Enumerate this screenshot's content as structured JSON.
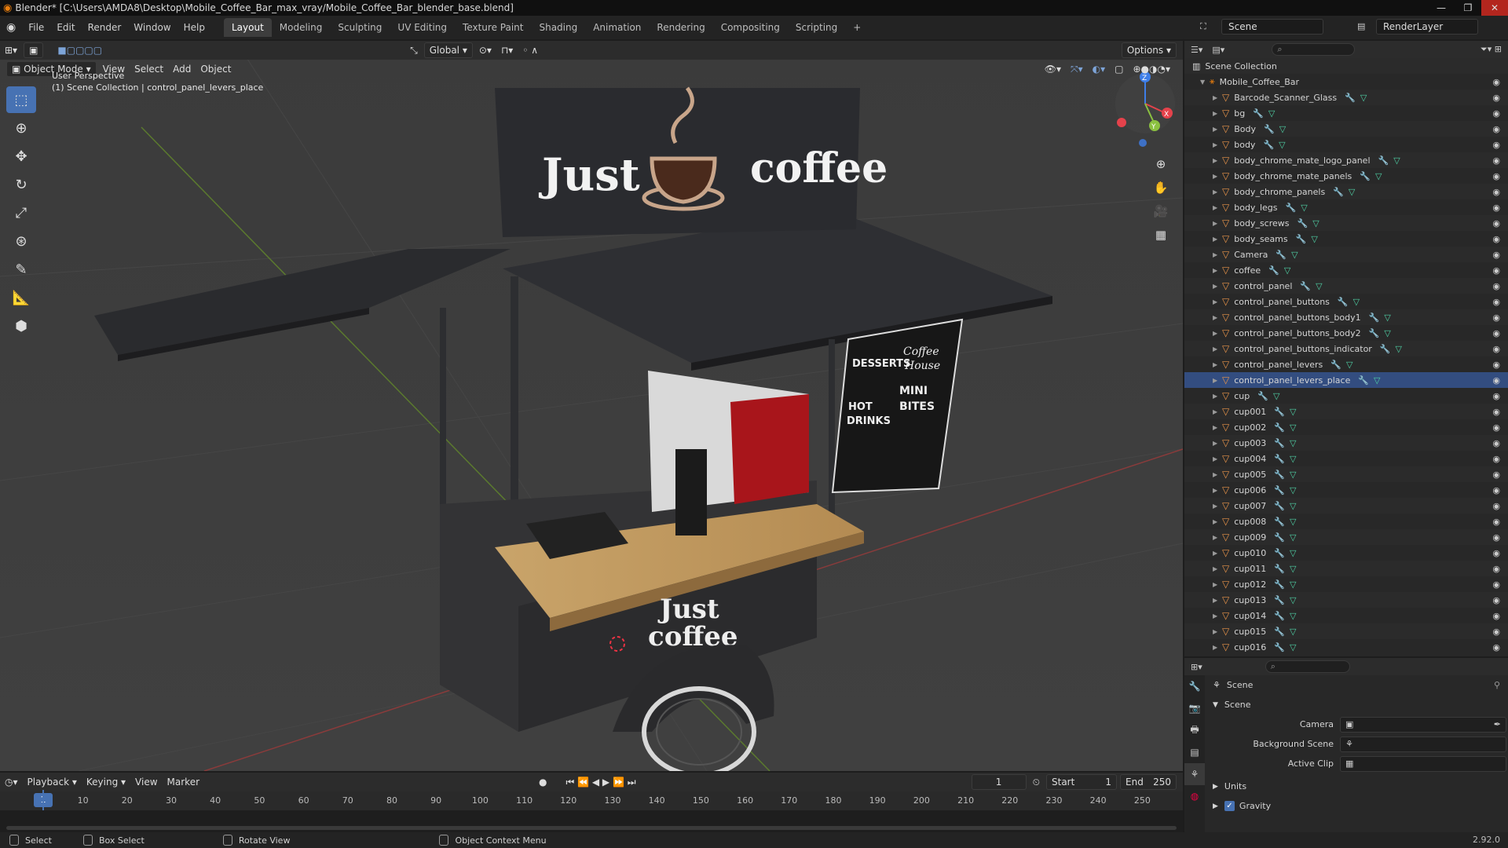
{
  "window": {
    "title": "Blender* [C:\\Users\\AMDA8\\Desktop\\Mobile_Coffee_Bar_max_vray/Mobile_Coffee_Bar_blender_base.blend]",
    "minimize": "—",
    "maximize": "❐",
    "close": "✕"
  },
  "menu": [
    "File",
    "Edit",
    "Render",
    "Window",
    "Help"
  ],
  "workspaces": [
    "Layout",
    "Modeling",
    "Sculpting",
    "UV Editing",
    "Texture Paint",
    "Shading",
    "Animation",
    "Rendering",
    "Compositing",
    "Scripting"
  ],
  "add_workspace": "+",
  "scene_field": "Scene",
  "view_layer_field": "RenderLayer",
  "viewport": {
    "mode": "Object Mode",
    "menus": [
      "View",
      "Select",
      "Add",
      "Object"
    ],
    "transform_orientation": "Global",
    "options": "Options",
    "perspective": "User Perspective",
    "collection_info": "(1) Scene Collection | control_panel_levers_place",
    "sign_text_left": "Just",
    "sign_text_right": "coffee",
    "cart_text_1": "Just",
    "cart_text_2": "coffee",
    "board_words": [
      "DESSERTS",
      "HOT",
      "DRINKS",
      "MINI",
      "BITES",
      "Coffee",
      "House"
    ],
    "gizmo_axes": [
      "Z",
      "X",
      "Y"
    ],
    "colors": {
      "x": "#e5424b",
      "y": "#8bc140",
      "z": "#3e7ee8",
      "accent": "#4772b3"
    }
  },
  "outliner": {
    "root": "Scene Collection",
    "collection": "Mobile_Coffee_Bar",
    "items": [
      "Barcode_Scanner_Glass",
      "bg",
      "Body",
      "body",
      "body_chrome_mate_logo_panel",
      "body_chrome_mate_panels",
      "body_chrome_panels",
      "body_legs",
      "body_screws",
      "body_seams",
      "Camera",
      "coffee",
      "control_panel",
      "control_panel_buttons",
      "control_panel_buttons_body1",
      "control_panel_buttons_body2",
      "control_panel_buttons_indicator",
      "control_panel_levers",
      "control_panel_levers_place",
      "cup",
      "cup001",
      "cup002",
      "cup003",
      "cup004",
      "cup005",
      "cup006",
      "cup007",
      "cup008",
      "cup009",
      "cup010",
      "cup011",
      "cup012",
      "cup013",
      "cup014",
      "cup015",
      "cup016"
    ],
    "selected": "control_panel_levers_place"
  },
  "properties": {
    "context": "Scene",
    "panel": "Scene",
    "fields": [
      {
        "label": "Camera",
        "value": ""
      },
      {
        "label": "Background Scene",
        "value": ""
      },
      {
        "label": "Active Clip",
        "value": ""
      }
    ],
    "units": "Units",
    "gravity": "Gravity"
  },
  "timeline": {
    "menus": [
      "Playback",
      "Keying",
      "View",
      "Marker"
    ],
    "current_frame": "1",
    "start_label": "Start",
    "start": "1",
    "end_label": "End",
    "end": "250",
    "ruler": [
      "10",
      "20",
      "30",
      "40",
      "50",
      "60",
      "70",
      "80",
      "90",
      "100",
      "110",
      "120",
      "130",
      "140",
      "150",
      "160",
      "170",
      "180",
      "190",
      "200",
      "210",
      "220",
      "230",
      "240",
      "250"
    ]
  },
  "status": {
    "select": "Select",
    "box_select": "Box Select",
    "rotate": "Rotate View",
    "context_menu": "Object Context Menu",
    "version": "2.92.0"
  }
}
